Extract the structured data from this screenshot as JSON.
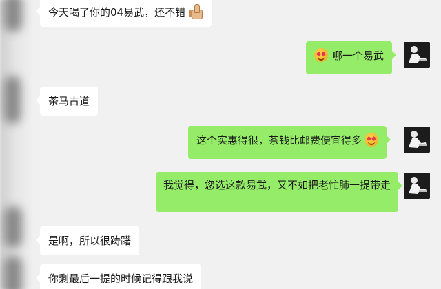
{
  "messages": [
    {
      "side": "in",
      "text": "今天喝了你的04易武，还不错",
      "emoji": "thumbs-up-icon"
    },
    {
      "side": "out",
      "text": "哪一个易武",
      "emoji": "heart-eyes-icon"
    },
    {
      "side": "in",
      "text": "茶马古道"
    },
    {
      "side": "out",
      "text": "这个实惠得很，茶钱比邮费便宜得多",
      "emoji": "heart-eyes-icon"
    },
    {
      "side": "out",
      "text": "我觉得，您选这款易武，又不如把老忙肺一提带走"
    },
    {
      "side": "in",
      "text": "是啊，所以很踌躇"
    },
    {
      "side": "in",
      "text": "你剩最后一提的时候记得跟我说"
    }
  ],
  "colors": {
    "background": "#f1f1f1",
    "incoming_bubble": "#ffffff",
    "outgoing_bubble": "#95ec69"
  }
}
